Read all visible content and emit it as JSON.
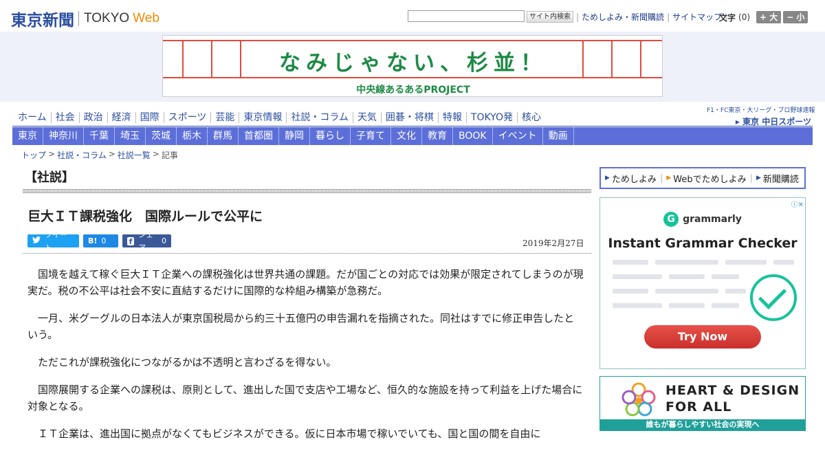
{
  "header": {
    "logo_jp": "東京新聞",
    "logo_en_1": "TOKYO",
    "logo_en_2": "Web",
    "search_placeholder": "",
    "search_button": "サイト内検索",
    "links": [
      "ためしよみ・新聞購読",
      "サイトマップ"
    ],
    "font_size_label": "文字",
    "font_size_level": "(0)",
    "font_larger": "+ 大",
    "font_smaller": "− 小"
  },
  "banner": {
    "title": "なみじゃない、杉並！",
    "subtitle": "中央線あるあるPROJECT"
  },
  "main_nav": [
    "ホーム",
    "社会",
    "政治",
    "経済",
    "国際",
    "スポーツ",
    "芸能",
    "東京情報",
    "社説・コラム",
    "天気",
    "囲碁・将棋",
    "特報",
    "TOKYO発",
    "核心"
  ],
  "chunichi_sports": {
    "line1": "F1・FC東京・大リーグ・プロ野球速報",
    "line2": "▸ 東京 中日スポーツ"
  },
  "region_nav": [
    "東京",
    "神奈川",
    "千葉",
    "埼玉",
    "茨城",
    "栃木",
    "群馬",
    "首都圏",
    "静岡",
    "暮らし",
    "子育て",
    "文化",
    "教育",
    "BOOK",
    "イベント",
    "動画"
  ],
  "breadcrumb": [
    "トップ",
    "社説・コラム",
    "社説一覧",
    "記事"
  ],
  "article": {
    "section": "【社説】",
    "headline": "巨大ＩＴ課税強化　国際ルールで公平に",
    "share": {
      "tweet": "ツイート",
      "hatena_icon": "B!",
      "hatena_count": "0",
      "facebook_icon": "f",
      "facebook_label": "シェア",
      "facebook_count": "0"
    },
    "date": "2019年2月27日",
    "paragraphs": [
      "国境を越えて稼ぐ巨大ＩＴ企業への課税強化は世界共通の課題。だが国ごとの対応では効果が限定されてしまうのが現実だ。税の不公平は社会不安に直結するだけに国際的な枠組み構築が急務だ。",
      "一月、米グーグルの日本法人が東京国税局から約三十五億円の申告漏れを指摘された。同社はすでに修正申告したという。",
      "ただこれが課税強化につながるかは不透明と言わざるを得ない。",
      "国際展開する企業への課税は、原則として、進出した国で支店や工場など、恒久的な施設を持って利益を上げた場合に対象となる。",
      "ＩＴ企業は、進出国に拠点がなくてもビジネスができる。仮に日本市場で稼いでいても、国と国の間を自由に"
    ]
  },
  "sidebar": {
    "promo_links": [
      "ためしよみ",
      "Webでためしよみ",
      "新聞購読"
    ],
    "ad1": {
      "brand": "grammarly",
      "headline": "Instant Grammar Checker",
      "cta": "Try Now",
      "adchoices": "ⓘ✕"
    },
    "ad2": {
      "line1": "HEART & DESIGN",
      "line2": "FOR ALL",
      "footer": "誰もが暮らしやすい社会の実現へ"
    }
  },
  "colors": {
    "brand_blue": "#2a4ea0",
    "nav_band": "#5c6fd9",
    "banner_green": "#1d8a45",
    "banner_red": "#e24a3a",
    "grammarly_green": "#15c39a",
    "cta_red": "#d9403a"
  }
}
